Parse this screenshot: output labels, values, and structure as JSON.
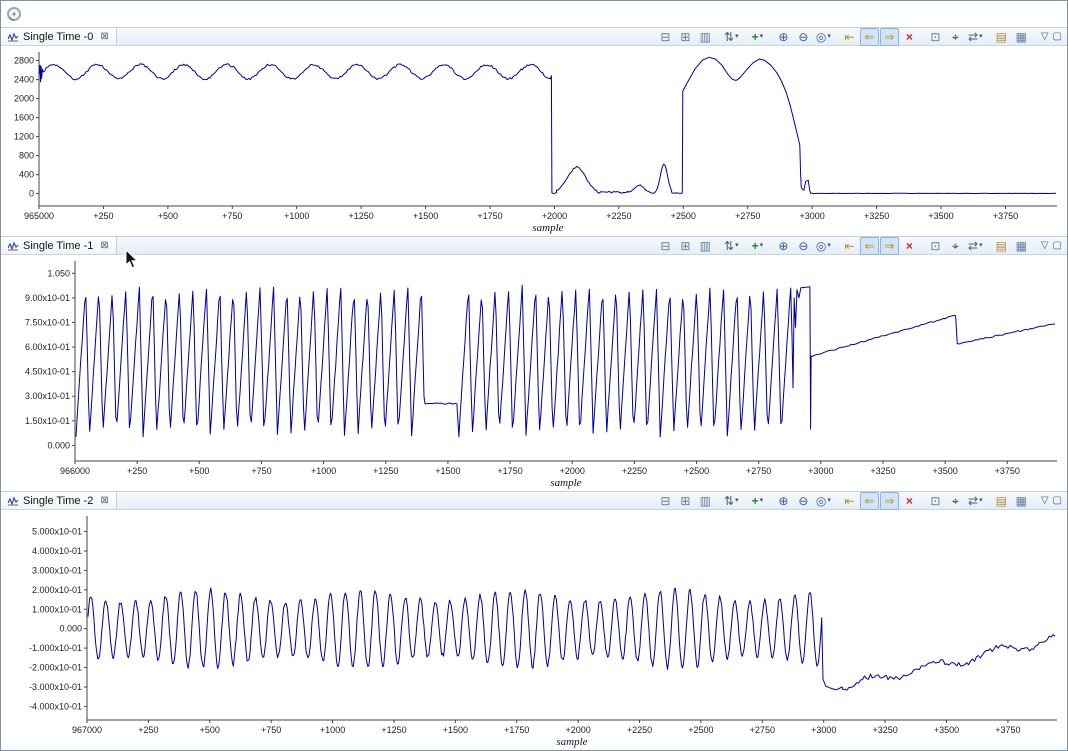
{
  "ui": {
    "close_glyph": "⊠",
    "caret_glyph": "▾"
  },
  "panels": [
    {
      "tab": {
        "title": "Single Time -0"
      }
    },
    {
      "tab": {
        "title": "Single Time -1"
      }
    },
    {
      "tab": {
        "title": "Single Time -2"
      }
    }
  ],
  "toolbar": {
    "icons": [
      {
        "name": "row-height-icon",
        "glyph": "⊟",
        "color": "#5f7d9c"
      },
      {
        "name": "fit-columns-icon",
        "glyph": "⊞",
        "color": "#5f7d9c"
      },
      {
        "name": "value-column-icon",
        "glyph": "▥",
        "color": "#5f7d9c"
      },
      {
        "name": "sort-icon",
        "glyph": "⇅",
        "color": "#44618a",
        "caret": true,
        "gap": true
      },
      {
        "name": "add-signal-icon",
        "glyph": "+",
        "color": "#1e8a1e",
        "caret": true,
        "gap": true,
        "bold": true
      },
      {
        "name": "zoom-in-icon",
        "glyph": "⊕",
        "color": "#2c5fa8",
        "gap": true
      },
      {
        "name": "zoom-out-icon",
        "glyph": "⊖",
        "color": "#2c5fa8"
      },
      {
        "name": "zoom-selection-icon",
        "glyph": "◎",
        "color": "#2c5fa8",
        "caret": true
      },
      {
        "name": "jump-start-icon",
        "glyph": "⇤",
        "color": "#c78d1b",
        "gap": true
      },
      {
        "name": "pan-left-icon",
        "glyph": "⇐",
        "color": "#c78d1b",
        "active": true
      },
      {
        "name": "pan-right-icon",
        "glyph": "⇒",
        "color": "#c78d1b",
        "active": true
      },
      {
        "name": "delete-signal-icon",
        "glyph": "×",
        "color": "#cc2a2a",
        "bold": true
      },
      {
        "name": "export-table-icon",
        "glyph": "⊡",
        "color": "#5f7d9c",
        "gap": true
      },
      {
        "name": "search-icon",
        "glyph": "⌖",
        "color": "#333333"
      },
      {
        "name": "sync-time-icon",
        "glyph": "⇄",
        "color": "#44618a",
        "caret": true
      },
      {
        "name": "report-icon",
        "glyph": "▤",
        "color": "#b08a2a",
        "gap": true
      },
      {
        "name": "grid-layout-icon",
        "glyph": "▦",
        "color": "#5f7d9c"
      }
    ],
    "right_icons": [
      {
        "name": "view-menu-icon",
        "glyph": "▽"
      },
      {
        "name": "maximize-view-icon",
        "glyph": "▢"
      }
    ]
  },
  "chart_data": [
    {
      "type": "line",
      "title": "Single Time -0",
      "xlabel": "sample",
      "line_color": "#0000a0",
      "xlim": [
        0,
        3950
      ],
      "ylim": [
        -260,
        2980
      ],
      "x_tick_values": [
        0,
        250,
        500,
        750,
        1000,
        1250,
        1500,
        1750,
        2000,
        2250,
        2500,
        2750,
        3000,
        3250,
        3500,
        3750
      ],
      "x_tick_labels": [
        "965000",
        "+250",
        "+500",
        "+750",
        "+1000",
        "+1250",
        "+1500",
        "+1750",
        "+2000",
        "+2250",
        "+2500",
        "+2750",
        "+3000",
        "+3250",
        "+3500",
        "+3750"
      ],
      "y_tick_values": [
        2800,
        2400,
        2000,
        1600,
        1200,
        800,
        400,
        0
      ],
      "y_tick_labels": [
        "2800",
        "2400",
        "2000",
        "1600",
        "1200",
        "800",
        "400",
        "0"
      ],
      "segments": [
        {
          "type": "points",
          "pts": [
            [
              2,
              2520
            ],
            [
              4,
              2700
            ],
            [
              6,
              2350
            ],
            [
              8,
              2680
            ],
            [
              10,
              2420
            ],
            [
              13,
              2620
            ]
          ]
        },
        {
          "type": "sine",
          "x0": 16,
          "x1": 1986,
          "mean": 2565,
          "amp": 150,
          "period": 168,
          "noise": 22,
          "step": 6
        },
        {
          "type": "points",
          "pts": [
            [
              1988,
              2480
            ],
            [
              1990,
              20
            ]
          ]
        },
        {
          "type": "flat",
          "x0": 1992,
          "x1": 2008,
          "y": 15,
          "noise": 10,
          "step": 8
        },
        {
          "type": "hump",
          "x0": 2008,
          "x1": 2165,
          "base": 15,
          "peak": 540,
          "noise": 18,
          "step": 6
        },
        {
          "type": "flat",
          "x0": 2165,
          "x1": 2285,
          "y": 30,
          "noise": 22,
          "step": 8
        },
        {
          "type": "hump",
          "x0": 2285,
          "x1": 2372,
          "base": 10,
          "peak": 170,
          "noise": 12,
          "step": 6
        },
        {
          "type": "flat",
          "x0": 2372,
          "x1": 2394,
          "y": 12,
          "noise": 8,
          "step": 8
        },
        {
          "type": "hump",
          "x0": 2394,
          "x1": 2456,
          "base": 8,
          "peak": 615,
          "noise": 10,
          "step": 5
        },
        {
          "type": "flat",
          "x0": 2456,
          "x1": 2496,
          "y": 10,
          "noise": 6,
          "step": 8
        },
        {
          "type": "points",
          "pts": [
            [
              2498,
              2160
            ],
            [
              2515,
              2330
            ],
            [
              2545,
              2620
            ],
            [
              2575,
              2810
            ],
            [
              2600,
              2868
            ],
            [
              2625,
              2830
            ],
            [
              2650,
              2700
            ],
            [
              2672,
              2520
            ],
            [
              2690,
              2405
            ],
            [
              2705,
              2380
            ],
            [
              2720,
              2440
            ],
            [
              2745,
              2600
            ],
            [
              2770,
              2750
            ],
            [
              2795,
              2830
            ],
            [
              2815,
              2808
            ],
            [
              2840,
              2700
            ],
            [
              2862,
              2550
            ],
            [
              2880,
              2380
            ],
            [
              2898,
              2150
            ],
            [
              2915,
              1850
            ],
            [
              2930,
              1520
            ],
            [
              2943,
              1230
            ],
            [
              2952,
              1020
            ],
            [
              2955,
              420
            ],
            [
              2958,
              120
            ],
            [
              2968,
              70
            ],
            [
              2975,
              260
            ],
            [
              2985,
              280
            ],
            [
              2990,
              80
            ],
            [
              2994,
              12
            ]
          ]
        },
        {
          "type": "flat",
          "x0": 2996,
          "x1": 3948,
          "y": 5,
          "noise": 3,
          "step": 10
        }
      ]
    },
    {
      "type": "line",
      "title": "Single Time -1",
      "xlabel": "sample",
      "line_color": "#0000a0",
      "xlim": [
        0,
        3950
      ],
      "ylim": [
        -0.095,
        1.125
      ],
      "x_tick_values": [
        0,
        250,
        500,
        750,
        1000,
        1250,
        1500,
        1750,
        2000,
        2250,
        2500,
        2750,
        3000,
        3250,
        3500,
        3750
      ],
      "x_tick_labels": [
        "966000",
        "+250",
        "+500",
        "+750",
        "+1000",
        "+1250",
        "+1500",
        "+1750",
        "+2000",
        "+2250",
        "+2500",
        "+2750",
        "+3000",
        "+3250",
        "+3500",
        "+3750"
      ],
      "y_tick_values": [
        1.05,
        0.9,
        0.75,
        0.6,
        0.45,
        0.3,
        0.15,
        0
      ],
      "y_tick_labels": [
        "1.050",
        "9.00x10-01",
        "7.50x10-01",
        "6.00x10-01",
        "4.50x10-01",
        "3.00x10-01",
        "1.50x10-01",
        "0.000"
      ],
      "segments": [
        {
          "type": "saw",
          "x0": 4,
          "x1": 1406,
          "min": 0.06,
          "max": 0.97,
          "period": 54,
          "rise": 0.72,
          "noise": 0.015,
          "step": 5
        },
        {
          "type": "flat",
          "x0": 1408,
          "x1": 1542,
          "y": 0.255,
          "noise": 0.004,
          "step": 8
        },
        {
          "type": "saw",
          "x0": 1544,
          "x1": 2886,
          "min": 0.06,
          "max": 0.97,
          "period": 54,
          "rise": 0.72,
          "noise": 0.015,
          "step": 5
        },
        {
          "type": "points",
          "pts": [
            [
              2888,
              0.35
            ],
            [
              2893,
              0.9
            ],
            [
              2898,
              0.72
            ],
            [
              2904,
              0.95
            ],
            [
              2912,
              0.9
            ],
            [
              2920,
              0.962
            ],
            [
              2940,
              0.965
            ],
            [
              2956,
              0.967
            ],
            [
              2959,
              0.1
            ],
            [
              2961,
              0.545
            ]
          ]
        },
        {
          "type": "ramp",
          "x0": 2962,
          "x1": 3546,
          "y0": 0.545,
          "y1": 0.795,
          "noise": 0.004,
          "step": 10
        },
        {
          "type": "points",
          "pts": [
            [
              3549,
              0.62
            ]
          ]
        },
        {
          "type": "ramp",
          "x0": 3552,
          "x1": 3948,
          "y0": 0.62,
          "y1": 0.745,
          "noise": 0.004,
          "step": 10
        }
      ]
    },
    {
      "type": "line",
      "title": "Single Time -2",
      "xlabel": "sample",
      "line_color": "#0000a0",
      "xlim": [
        0,
        3950
      ],
      "ylim": [
        -0.47,
        0.58
      ],
      "x_tick_values": [
        0,
        250,
        500,
        750,
        1000,
        1250,
        1500,
        1750,
        2000,
        2250,
        2500,
        2750,
        3000,
        3250,
        3500,
        3750
      ],
      "x_tick_labels": [
        "967000",
        "+250",
        "+500",
        "+750",
        "+1000",
        "+1250",
        "+1500",
        "+1750",
        "+2000",
        "+2250",
        "+2500",
        "+2750",
        "+3000",
        "+3250",
        "+3500",
        "+3750"
      ],
      "y_tick_values": [
        0.5,
        0.4,
        0.3,
        0.2,
        0.1,
        0,
        -0.1,
        -0.2,
        -0.3,
        -0.4
      ],
      "y_tick_labels": [
        "5.000x10-01",
        "4.000x10-01",
        "3.000x10-01",
        "2.000x10-01",
        "1.000x10-01",
        "0.000",
        "-1.000x10-01",
        "-2.000x10-01",
        "-3.000x10-01",
        "-4.000x10-01"
      ],
      "segments": [
        {
          "type": "beat",
          "x0": 4,
          "x1": 2994,
          "mean": 0,
          "amp": 0.2,
          "period": 61,
          "beat_period": 640,
          "beat_depth": 0.3,
          "noise": 0.013,
          "step": 4
        },
        {
          "type": "points",
          "pts": [
            [
              2997,
              -0.26
            ],
            [
              3008,
              -0.295
            ],
            [
              3025,
              -0.305
            ],
            [
              3050,
              -0.315
            ],
            [
              3075,
              -0.3
            ]
          ]
        },
        {
          "type": "ramp",
          "x0": 3078,
          "x1": 3948,
          "y0": -0.3,
          "y1": -0.05,
          "noise": 0.013,
          "wiggle_amp": 0.022,
          "wiggle_period": 260,
          "step": 8
        }
      ]
    }
  ]
}
